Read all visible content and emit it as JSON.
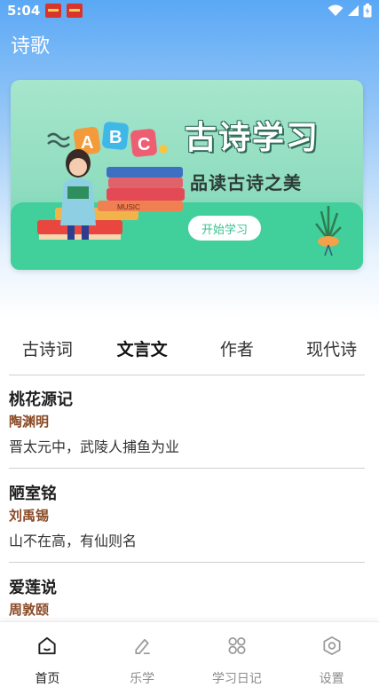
{
  "status_bar": {
    "time": "5:04"
  },
  "app": {
    "title": "诗歌"
  },
  "banner": {
    "title": "古诗学习",
    "subtitle": "品读古诗之美",
    "button_label": "开始学习",
    "abc": [
      "A",
      "B",
      "C"
    ],
    "book_spine": "MUSIC"
  },
  "tabs": [
    {
      "label": "古诗词",
      "active": false
    },
    {
      "label": "文言文",
      "active": true
    },
    {
      "label": "作者",
      "active": false
    },
    {
      "label": "现代诗",
      "active": false
    }
  ],
  "poems": [
    {
      "title": "桃花源记",
      "author": "陶渊明",
      "line": "晋太元中，武陵人捕鱼为业"
    },
    {
      "title": "陋室铭",
      "author": "刘禹锡",
      "line": "山不在高，有仙则名"
    },
    {
      "title": "爱莲说",
      "author": "周敦颐",
      "line": ""
    }
  ],
  "bottom_nav": [
    {
      "label": "首页",
      "icon": "home-icon",
      "active": true
    },
    {
      "label": "乐学",
      "icon": "edit-icon",
      "active": false
    },
    {
      "label": "学习日记",
      "icon": "grid-icon",
      "active": false
    },
    {
      "label": "设置",
      "icon": "hexagon-settings-icon",
      "active": false
    }
  ],
  "colors": {
    "header_blue": "#5aa8f5",
    "banner_green": "#41cf9c",
    "author_brown": "#8a4a25"
  }
}
